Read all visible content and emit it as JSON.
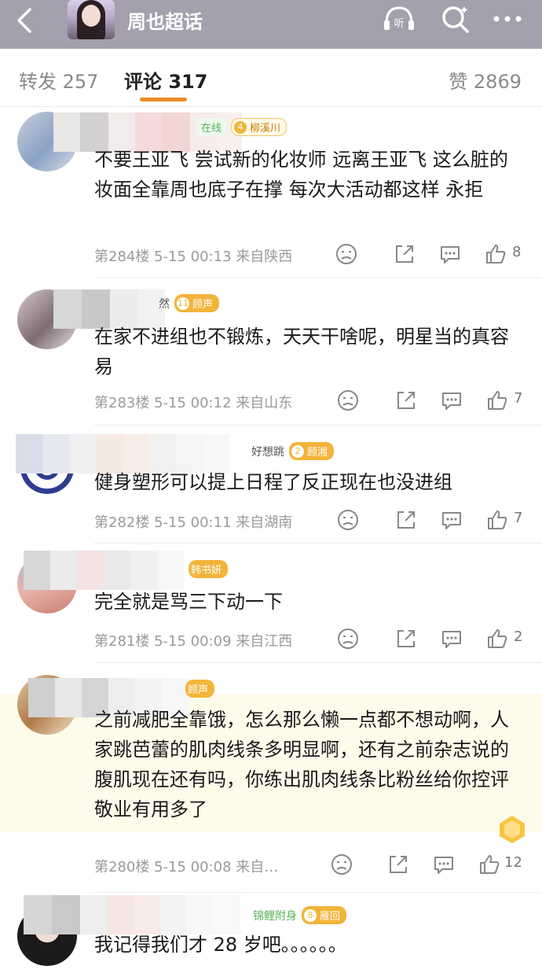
{
  "header": {
    "title": "周也超话"
  },
  "tabs": {
    "repost": "转发 257",
    "comments": "评论 317",
    "likes": "赞 2869"
  },
  "comments": [
    {
      "badge_online": "在线",
      "badge_lv": "4",
      "badge_name": "柳溪川",
      "text": "不要王亚飞 尝试新的化妆师 远离王亚飞 这么脏的妆面全靠周也底子在撑 每次大活动都这样 永拒",
      "meta": "第284楼 5-15 00:13 来自陕西",
      "likes": "8"
    },
    {
      "badge_suffix": "然",
      "badge_lv": "11",
      "badge_name": "顾声",
      "text": "在家不进组也不锻炼，天天干啥呢，明星当的真容易",
      "meta": "第283楼 5-15 00:12 来自山东",
      "likes": "7"
    },
    {
      "badge_suffix": "好想跳",
      "badge_lv": "2",
      "badge_name": "顾湘",
      "text": "健身塑形可以提上日程了反正现在也没进组",
      "meta": "第282楼 5-15 00:11 来自湖南",
      "likes": "7"
    },
    {
      "badge_name": "韩书妍",
      "text": "完全就是骂三下动一下",
      "meta": "第281楼 5-15 00:09 来自江西",
      "likes": "2"
    },
    {
      "badge_name": "顾声",
      "text": "之前减肥全靠饿，怎么那么懒一点都不想动啊，人家跳芭蕾的肌肉线条多明显啊，还有之前杂志说的腹肌现在还有吗，你练出肌肉线条比粉丝给你控评敬业有用多了",
      "meta": "第280楼 5-15 00:08 来自…",
      "likes": "12"
    },
    {
      "badge_prefix": "锦鲤附身",
      "badge_lv": "8",
      "badge_name": "雁回",
      "text": "我记得我们才 28 岁吧。。。。。。",
      "meta": "",
      "likes": ""
    }
  ],
  "icons": [
    "back-icon",
    "listen-icon",
    "search-icon",
    "more-icon",
    "dislike-icon",
    "share-icon",
    "comment-icon",
    "like-icon"
  ],
  "colors": {
    "accent": "#f08a24",
    "topbar": "#a4a0ae",
    "badge": "#f3b43a"
  }
}
